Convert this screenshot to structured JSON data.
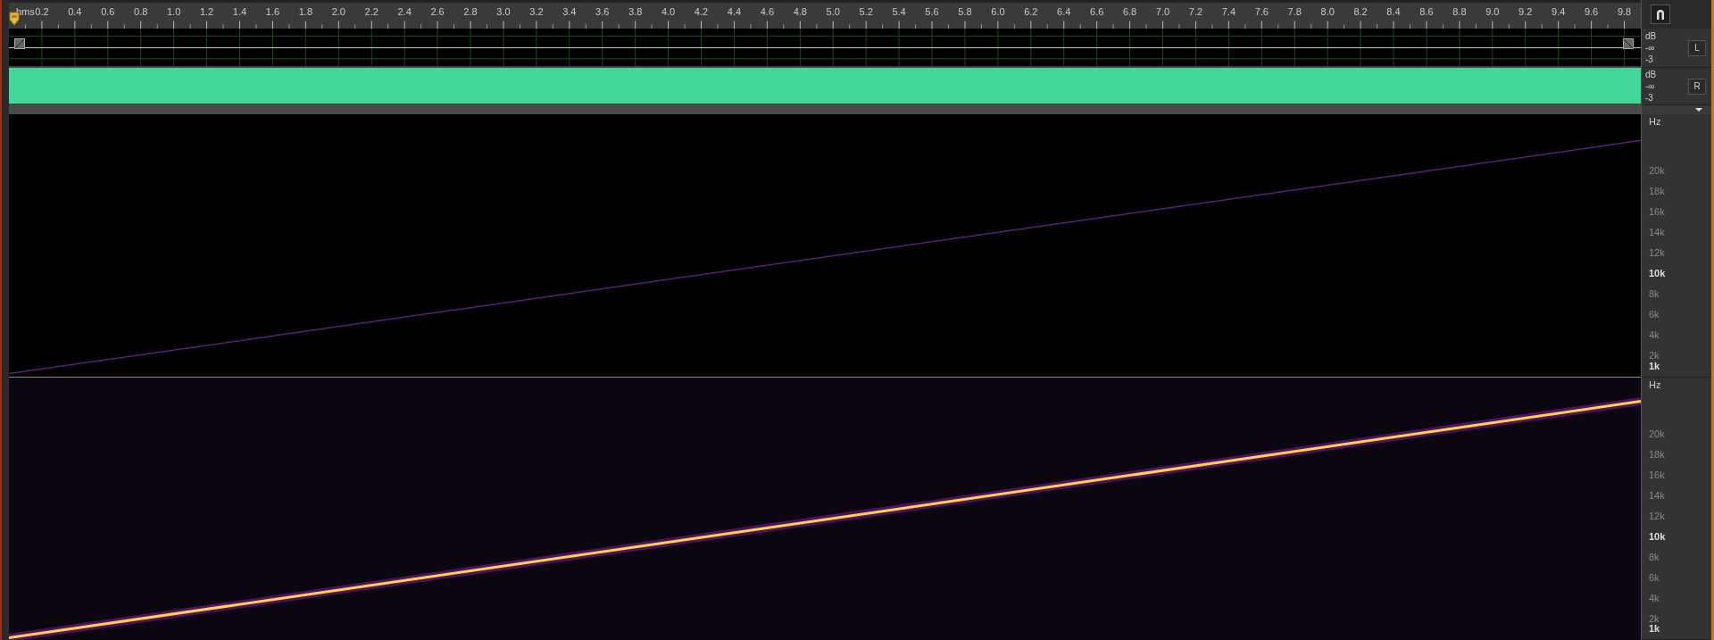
{
  "ruler": {
    "unit": "hms",
    "labels": [
      "0.2",
      "0.4",
      "0.6",
      "0.8",
      "1.0",
      "1.2",
      "1.4",
      "1.6",
      "1.8",
      "2.0",
      "2.2",
      "2.4",
      "2.6",
      "2.8",
      "3.0",
      "3.2",
      "3.4",
      "3.6",
      "3.8",
      "4.0",
      "4.2",
      "4.4",
      "4.6",
      "4.8",
      "5.0",
      "5.2",
      "5.4",
      "5.6",
      "5.8",
      "6.0",
      "6.2",
      "6.4",
      "6.6",
      "6.8",
      "7.0",
      "7.2",
      "7.4",
      "7.6",
      "7.8",
      "8.0",
      "8.2",
      "8.4",
      "8.6",
      "8.8",
      "9.0",
      "9.2",
      "9.4",
      "9.6",
      "9.8"
    ]
  },
  "channels": [
    {
      "name": "L",
      "kind": "flat",
      "scale": [
        "dB",
        "-∞",
        "-3"
      ]
    },
    {
      "name": "R",
      "kind": "filled",
      "scale": [
        "dB",
        "-∞",
        "-3"
      ]
    }
  ],
  "spectral": [
    {
      "kind": "dim",
      "unit": "Hz",
      "labels": [
        {
          "text": "20k",
          "major": false
        },
        {
          "text": "18k",
          "major": false
        },
        {
          "text": "16k",
          "major": false
        },
        {
          "text": "14k",
          "major": false
        },
        {
          "text": "12k",
          "major": false
        },
        {
          "text": "10k",
          "major": true
        },
        {
          "text": "8k",
          "major": false
        },
        {
          "text": "6k",
          "major": false
        },
        {
          "text": "4k",
          "major": false
        },
        {
          "text": "2k",
          "major": false
        },
        {
          "text": "1k",
          "major": true
        }
      ]
    },
    {
      "kind": "bright",
      "unit": "Hz",
      "labels": [
        {
          "text": "20k",
          "major": false
        },
        {
          "text": "18k",
          "major": false
        },
        {
          "text": "16k",
          "major": false
        },
        {
          "text": "14k",
          "major": false
        },
        {
          "text": "12k",
          "major": false
        },
        {
          "text": "10k",
          "major": true
        },
        {
          "text": "8k",
          "major": false
        },
        {
          "text": "6k",
          "major": false
        },
        {
          "text": "4k",
          "major": false
        },
        {
          "text": "2k",
          "major": false
        },
        {
          "text": "1k",
          "major": true
        }
      ]
    }
  ]
}
